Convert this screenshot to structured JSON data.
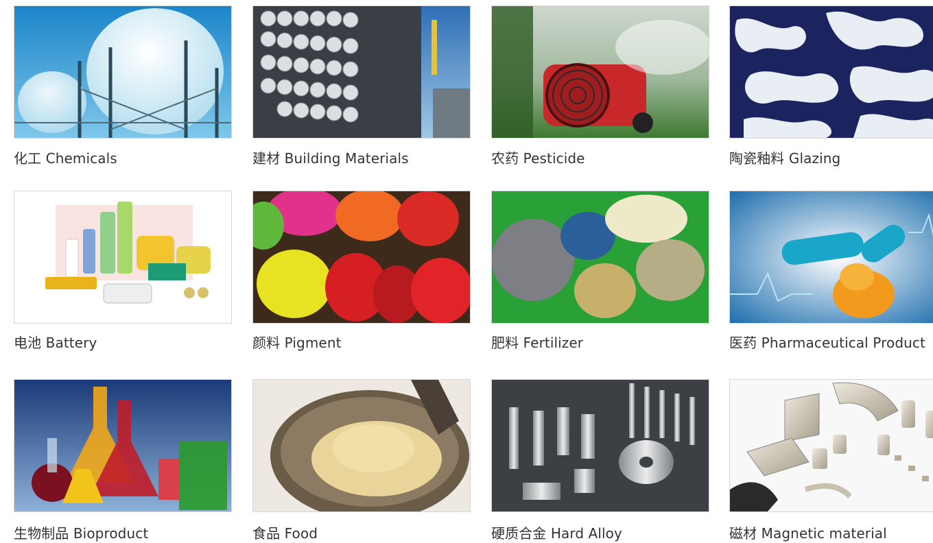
{
  "categories": [
    {
      "label": "化工 Chemicals",
      "image": "chemicals-image"
    },
    {
      "label": "建材 Building Materials",
      "image": "building-materials-image"
    },
    {
      "label": "农药 Pesticide",
      "image": "pesticide-image"
    },
    {
      "label": "陶瓷釉料 Glazing",
      "image": "glazing-image"
    },
    {
      "label": "电池 Battery",
      "image": "battery-image"
    },
    {
      "label": "颜料 Pigment",
      "image": "pigment-image"
    },
    {
      "label": "肥料 Fertilizer",
      "image": "fertilizer-image"
    },
    {
      "label": "医药 Pharmaceutical Product",
      "image": "pharmaceutical-image"
    },
    {
      "label": "生物制品 Bioproduct",
      "image": "bioproduct-image"
    },
    {
      "label": "食品 Food",
      "image": "food-image"
    },
    {
      "label": "硬质合金 Hard Alloy",
      "image": "hard-alloy-image"
    },
    {
      "label": "磁材 Magnetic material",
      "image": "magnetic-material-image"
    }
  ]
}
